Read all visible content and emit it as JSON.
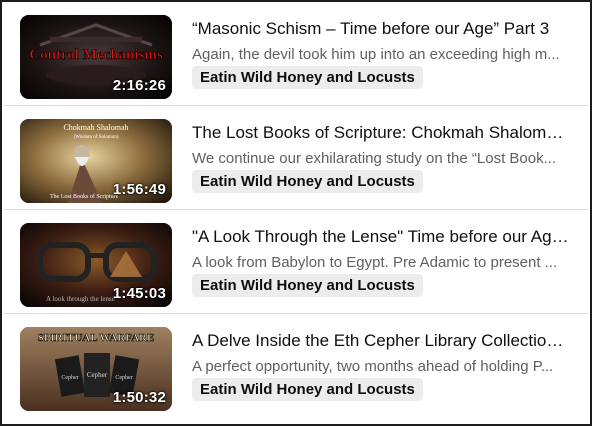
{
  "videos": [
    {
      "title": "“Masonic Schism – Time before our Age” Part 3",
      "description": "Again, the devil took him up into an exceeding high m...",
      "channel": "Eatin Wild Honey and Locusts",
      "duration": "2:16:26",
      "thumbnail_text": "Control Mechanisms",
      "thumbnail_icon": "masonic-thumbnail"
    },
    {
      "title": "The Lost Books of Scripture: Chokmah Shalomah (...",
      "description": "We continue our exhilarating study on the “Lost Book...",
      "channel": "Eatin Wild Honey and Locusts",
      "duration": "1:56:49",
      "thumbnail_text": "Chokmah Shalomah",
      "thumbnail_subtext": "(Wisdom of Solomon)",
      "thumbnail_footer": "The Lost Books of Scripture",
      "thumbnail_icon": "solomon-thumbnail"
    },
    {
      "title": "\"A Look Through the Lense\" Time before our Age P...",
      "description": "A look from Babylon to Egypt. Pre Adamic to present ...",
      "channel": "Eatin Wild Honey and Locusts",
      "duration": "1:45:03",
      "thumbnail_text": "A look through the lense",
      "thumbnail_icon": "glasses-thumbnail"
    },
    {
      "title": "A Delve Inside the Eth Cepher Library Collection & ...",
      "description": "A perfect opportunity, two months ahead of holding P...",
      "channel": "Eatin Wild Honey and Locusts",
      "duration": "1:50:32",
      "thumbnail_text": "SPIRITUAL WARFARE",
      "thumbnail_book_labels": [
        "Cepher",
        "Cepher",
        "Cepher"
      ],
      "thumbnail_icon": "books-thumbnail"
    }
  ],
  "colors": {
    "title": "#0f0f0f",
    "description": "#606060",
    "channel_bg": "#ececec",
    "divider": "#dedede"
  }
}
